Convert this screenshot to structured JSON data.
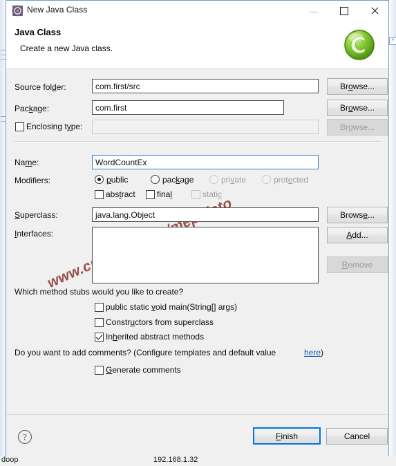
{
  "window": {
    "title": "New Java Class",
    "icon": "java-class-wizard-icon",
    "controls": {
      "minimize": "minimize-icon",
      "maximize": "maximize-icon",
      "close": "close-icon"
    }
  },
  "banner": {
    "title": "Java Class",
    "subtitle": "Create a new Java class.",
    "icon": "green-c-badge-icon"
  },
  "form": {
    "source_folder": {
      "label": "Source folder:",
      "value": "com.first/src",
      "button": "Browse..."
    },
    "package": {
      "label": "Package:",
      "value": "com.first",
      "button": "Browse..."
    },
    "enclosing_type": {
      "label": "Enclosing type:",
      "value": "",
      "checked": false,
      "button": "Browse...",
      "enabled": false
    },
    "name": {
      "label": "Name:",
      "value": "WordCountEx"
    },
    "modifiers": {
      "label": "Modifiers:",
      "access": [
        {
          "label": "public",
          "selected": true,
          "enabled": true
        },
        {
          "label": "package",
          "selected": false,
          "enabled": true
        },
        {
          "label": "private",
          "selected": false,
          "enabled": false
        },
        {
          "label": "protected",
          "selected": false,
          "enabled": false
        }
      ],
      "flags": [
        {
          "label": "abstract",
          "checked": false,
          "enabled": true
        },
        {
          "label": "final",
          "checked": false,
          "enabled": true
        },
        {
          "label": "static",
          "checked": false,
          "enabled": false
        }
      ]
    },
    "superclass": {
      "label": "Superclass:",
      "value": "java.lang.Object",
      "button": "Browse..."
    },
    "interfaces": {
      "label": "Interfaces:",
      "items": [],
      "add_button": "Add...",
      "remove_button": "Remove",
      "remove_enabled": false
    }
  },
  "stubs": {
    "question": "Which method stubs would you like to create?",
    "options": [
      {
        "label": "public static void main(String[] args)",
        "checked": false
      },
      {
        "label": "Constructors from superclass",
        "checked": false
      },
      {
        "label": "Inherited abstract methods",
        "checked": true
      }
    ]
  },
  "comments": {
    "question_prefix": "Do you want to add comments? (Configure templates and default value ",
    "link": "here",
    "question_suffix": ")",
    "option": {
      "label": "Generate comments",
      "checked": false
    }
  },
  "footer": {
    "help": "help-icon",
    "finish": "Finish",
    "cancel": "Cancel"
  },
  "watermark": {
    "text": "www.cnblogs.com/mephisto",
    "color": "#8c3a35"
  },
  "background": {
    "left_text": "doop",
    "center_text": "192.168.1.32"
  }
}
